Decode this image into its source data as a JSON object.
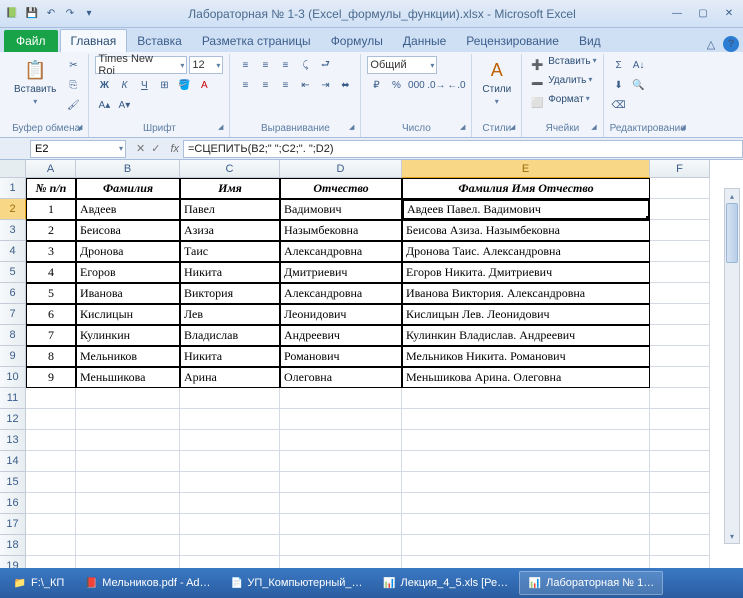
{
  "title": "Лабораторная № 1-3 (Excel_формулы_функции).xlsx - Microsoft Excel",
  "file_tab": "Файл",
  "tabs": [
    "Главная",
    "Вставка",
    "Разметка страницы",
    "Формулы",
    "Данные",
    "Рецензирование",
    "Вид"
  ],
  "active_tab": 0,
  "ribbon": {
    "clipboard": {
      "label": "Буфер обмена",
      "paste": "Вставить"
    },
    "font": {
      "label": "Шрифт",
      "name": "Times New Roi",
      "size": "12"
    },
    "align": {
      "label": "Выравнивание"
    },
    "number": {
      "label": "Число",
      "format": "Общий"
    },
    "styles": {
      "label": "Стили",
      "btn": "Стили"
    },
    "cells": {
      "label": "Ячейки",
      "insert": "Вставить",
      "delete": "Удалить",
      "format": "Формат"
    },
    "editing": {
      "label": "Редактирование"
    }
  },
  "name_box": "E2",
  "formula": "=СЦЕПИТЬ(B2;\" \";C2;\". \";D2)",
  "columns": [
    "A",
    "B",
    "C",
    "D",
    "E",
    "F"
  ],
  "headers": {
    "A": "№ п/п",
    "B": "Фамилия",
    "C": "Имя",
    "D": "Отчество",
    "E": "Фамилия Имя Отчество"
  },
  "rows": [
    {
      "n": "1",
      "b": "Авдеев",
      "c": "Павел",
      "d": "Вадимович",
      "e": "Авдеев Павел. Вадимович"
    },
    {
      "n": "2",
      "b": "Беисова",
      "c": "Азиза",
      "d": "Назымбековна",
      "e": "Беисова Азиза. Назымбековна"
    },
    {
      "n": "3",
      "b": "Дронова",
      "c": "Таис",
      "d": "Александровна",
      "e": "Дронова Таис. Александровна"
    },
    {
      "n": "4",
      "b": "Егоров",
      "c": "Никита",
      "d": "Дмитриевич",
      "e": "Егоров Никита. Дмитриевич"
    },
    {
      "n": "5",
      "b": "Иванова",
      "c": "Виктория",
      "d": "Александровна",
      "e": "Иванова Виктория. Александровна"
    },
    {
      "n": "6",
      "b": "Кислицын",
      "c": "Лев",
      "d": "Леонидович",
      "e": "Кислицын Лев. Леонидович"
    },
    {
      "n": "7",
      "b": "Кулинкин",
      "c": "Владислав",
      "d": "Андреевич",
      "e": "Кулинкин Владислав. Андреевич"
    },
    {
      "n": "8",
      "b": "Мельников",
      "c": "Никита",
      "d": "Романович",
      "e": "Мельников Никита. Романович"
    },
    {
      "n": "9",
      "b": "Меньшикова",
      "c": "Арина",
      "d": "Олеговна",
      "e": "Меньшикова Арина. Олеговна"
    }
  ],
  "taskbar": [
    {
      "label": "F:\\_КП",
      "ico": "📁"
    },
    {
      "label": "Мельников.pdf - Ad…",
      "ico": "📕"
    },
    {
      "label": "УП_Компьютерный_…",
      "ico": "📄"
    },
    {
      "label": "Лекция_4_5.xls [Ре…",
      "ico": "📊"
    },
    {
      "label": "Лабораторная № 1…",
      "ico": "📊",
      "active": true
    }
  ]
}
